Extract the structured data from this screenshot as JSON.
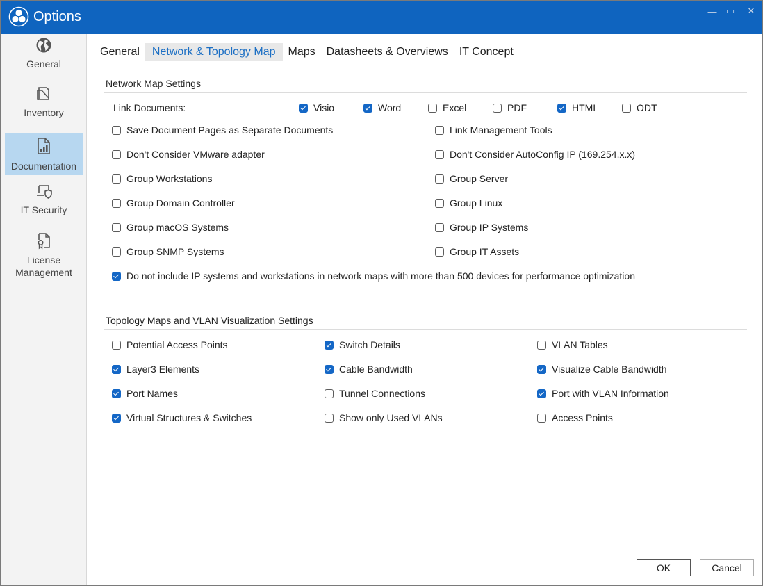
{
  "window": {
    "title": "Options",
    "controls": {
      "minimize": "—",
      "maximize": "▭",
      "close": "✕"
    }
  },
  "sidebar": {
    "items": [
      {
        "label": "General",
        "icon": "globe-icon",
        "active": false
      },
      {
        "label": "Inventory",
        "icon": "inventory-icon",
        "active": false
      },
      {
        "label": "Documentation",
        "icon": "document-chart-icon",
        "active": true
      },
      {
        "label": "IT Security",
        "icon": "laptop-shield-icon",
        "active": false
      },
      {
        "label": "License Management",
        "icon": "certificate-icon",
        "active": false
      }
    ]
  },
  "tabs": [
    {
      "label": "General",
      "active": false
    },
    {
      "label": "Network & Topology Map",
      "active": true
    },
    {
      "label": "Maps",
      "active": false
    },
    {
      "label": "Datasheets & Overviews",
      "active": false
    },
    {
      "label": "IT Concept",
      "active": false
    }
  ],
  "network": {
    "title": "Network Map Settings",
    "link_documents_label": "Link Documents:",
    "link_documents": [
      {
        "label": "Visio",
        "checked": true
      },
      {
        "label": "Word",
        "checked": true
      },
      {
        "label": "Excel",
        "checked": false
      },
      {
        "label": "PDF",
        "checked": false
      },
      {
        "label": "HTML",
        "checked": true
      },
      {
        "label": "ODT",
        "checked": false
      }
    ],
    "left": [
      {
        "label": "Save Document Pages as Separate Documents",
        "checked": false
      },
      {
        "label": "Don't Consider VMware adapter",
        "checked": false
      },
      {
        "label": "Group Workstations",
        "checked": false
      },
      {
        "label": "Group Domain Controller",
        "checked": false
      },
      {
        "label": "Group macOS Systems",
        "checked": false
      },
      {
        "label": "Group SNMP Systems",
        "checked": false
      }
    ],
    "right": [
      {
        "label": "Link Management Tools",
        "checked": false
      },
      {
        "label": "Don't Consider AutoConfig IP (169.254.x.x)",
        "checked": false
      },
      {
        "label": "Group Server",
        "checked": false
      },
      {
        "label": "Group Linux",
        "checked": false
      },
      {
        "label": "Group IP Systems",
        "checked": false
      },
      {
        "label": "Group IT Assets",
        "checked": false
      }
    ],
    "performance": {
      "label": "Do not include IP systems and workstations in network maps with more than 500 devices for performance optimization",
      "checked": true
    }
  },
  "topology": {
    "title": "Topology Maps and VLAN Visualization Settings",
    "col1": [
      {
        "label": "Potential Access Points",
        "checked": false
      },
      {
        "label": "Layer3 Elements",
        "checked": true
      },
      {
        "label": "Port Names",
        "checked": true
      },
      {
        "label": "Virtual Structures & Switches",
        "checked": true
      }
    ],
    "col2": [
      {
        "label": "Switch Details",
        "checked": true
      },
      {
        "label": "Cable Bandwidth",
        "checked": true
      },
      {
        "label": "Tunnel Connections",
        "checked": false
      },
      {
        "label": "Show only Used VLANs",
        "checked": false
      }
    ],
    "col3": [
      {
        "label": "VLAN Tables",
        "checked": false
      },
      {
        "label": "Visualize Cable Bandwidth",
        "checked": true
      },
      {
        "label": "Port with VLAN Information",
        "checked": true
      },
      {
        "label": "Access Points",
        "checked": false
      }
    ]
  },
  "buttons": {
    "ok": "OK",
    "cancel": "Cancel"
  },
  "colors": {
    "titlebar": "#0f64bf",
    "accent": "#1467c6",
    "active_nav": "#b7d7f0"
  }
}
